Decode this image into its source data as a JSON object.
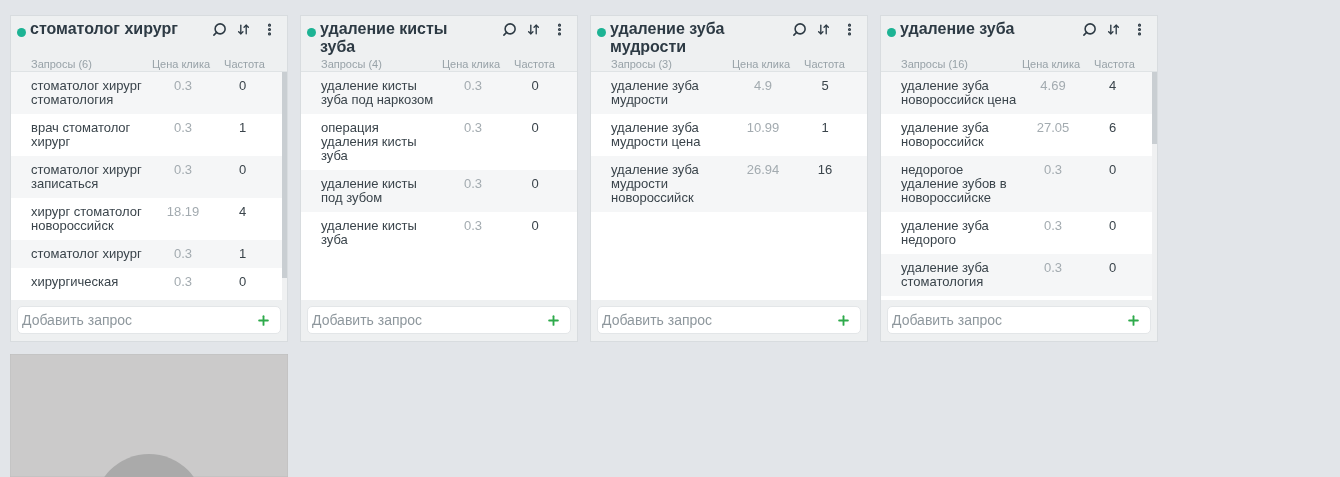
{
  "cards": [
    {
      "title": "стоматолог хирург",
      "columns": [
        "Запросы (6)",
        "Цена клика",
        "Частота"
      ],
      "scrollable": true,
      "rows": [
        {
          "query": "стоматолог хирург стоматология",
          "price": "0.3",
          "freq": "0"
        },
        {
          "query": "врач стоматолог хирург",
          "price": "0.3",
          "freq": "1"
        },
        {
          "query": "стоматолог хирург записаться",
          "price": "0.3",
          "freq": "0"
        },
        {
          "query": "хирург стоматолог новороссийск",
          "price": "18.19",
          "freq": "4"
        },
        {
          "query": "стоматолог хирург",
          "price": "0.3",
          "freq": "1"
        },
        {
          "query": "хирургическая",
          "price": "0.3",
          "freq": "0"
        }
      ],
      "add_placeholder": "Добавить запрос"
    },
    {
      "title": "удаление кисты зуба",
      "columns": [
        "Запросы (4)",
        "Цена клика",
        "Частота"
      ],
      "scrollable": false,
      "rows": [
        {
          "query": "удаление кисты зуба под наркозом",
          "price": "0.3",
          "freq": "0"
        },
        {
          "query": "операция удаления кисты зуба",
          "price": "0.3",
          "freq": "0"
        },
        {
          "query": "удаление кисты под зубом",
          "price": "0.3",
          "freq": "0"
        },
        {
          "query": "удаление кисты зуба",
          "price": "0.3",
          "freq": "0"
        }
      ],
      "add_placeholder": "Добавить запрос"
    },
    {
      "title": "удаление зуба мудрости",
      "columns": [
        "Запросы (3)",
        "Цена клика",
        "Частота"
      ],
      "scrollable": false,
      "rows": [
        {
          "query": "удаление зуба мудрости",
          "price": "4.9",
          "freq": "5"
        },
        {
          "query": "удаление зуба мудрости цена",
          "price": "10.99",
          "freq": "1"
        },
        {
          "query": "удаление зуба мудрости новороссийск",
          "price": "26.94",
          "freq": "16"
        }
      ],
      "add_placeholder": "Добавить запрос"
    },
    {
      "title": "удаление зуба",
      "columns": [
        "Запросы (16)",
        "Цена клика",
        "Частота"
      ],
      "scrollable": true,
      "rows": [
        {
          "query": "удаление зуба новороссийск цена",
          "price": "4.69",
          "freq": "4"
        },
        {
          "query": "удаление зуба новороссийск",
          "price": "27.05",
          "freq": "6"
        },
        {
          "query": "недорогое удаление зубов в новороссийске",
          "price": "0.3",
          "freq": "0"
        },
        {
          "query": "удаление зуба недорого",
          "price": "0.3",
          "freq": "0"
        },
        {
          "query": "удаление зуба стоматология",
          "price": "0.3",
          "freq": "0"
        }
      ],
      "add_placeholder": "Добавить запрос"
    }
  ]
}
